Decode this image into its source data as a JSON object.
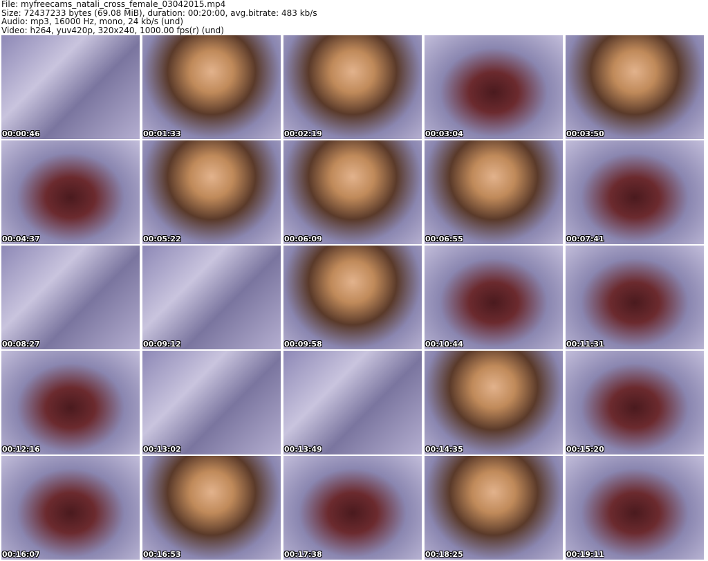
{
  "info": {
    "file": "File: myfreecams_natali_cross_female_03042015.mp4",
    "size": "Size: 72437233 bytes (69.08 MiB), duration: 00:20:00, avg.bitrate: 483 kb/s",
    "audio": "Audio: mp3, 16000 Hz, mono, 24 kb/s (und)",
    "video": "Video: h264, yuv420p, 320x240, 1000.00 fps(r) (und)"
  },
  "thumbnails": [
    {
      "time": "00:00:46",
      "kind": "wall"
    },
    {
      "time": "00:01:33",
      "kind": "person"
    },
    {
      "time": "00:02:19",
      "kind": "person"
    },
    {
      "time": "00:03:04",
      "kind": "dress"
    },
    {
      "time": "00:03:50",
      "kind": "person"
    },
    {
      "time": "00:04:37",
      "kind": "dress"
    },
    {
      "time": "00:05:22",
      "kind": "person"
    },
    {
      "time": "00:06:09",
      "kind": "person"
    },
    {
      "time": "00:06:55",
      "kind": "person"
    },
    {
      "time": "00:07:41",
      "kind": "dress"
    },
    {
      "time": "00:08:27",
      "kind": "wall"
    },
    {
      "time": "00:09:12",
      "kind": "wall"
    },
    {
      "time": "00:09:58",
      "kind": "person"
    },
    {
      "time": "00:10:44",
      "kind": "dress"
    },
    {
      "time": "00:11:31",
      "kind": "dress"
    },
    {
      "time": "00:12:16",
      "kind": "dress"
    },
    {
      "time": "00:13:02",
      "kind": "wall"
    },
    {
      "time": "00:13:49",
      "kind": "wall"
    },
    {
      "time": "00:14:35",
      "kind": "person"
    },
    {
      "time": "00:15:20",
      "kind": "dress"
    },
    {
      "time": "00:16:07",
      "kind": "dress"
    },
    {
      "time": "00:16:53",
      "kind": "person"
    },
    {
      "time": "00:17:38",
      "kind": "dress"
    },
    {
      "time": "00:18:25",
      "kind": "person"
    },
    {
      "time": "00:19:11",
      "kind": "dress"
    }
  ]
}
